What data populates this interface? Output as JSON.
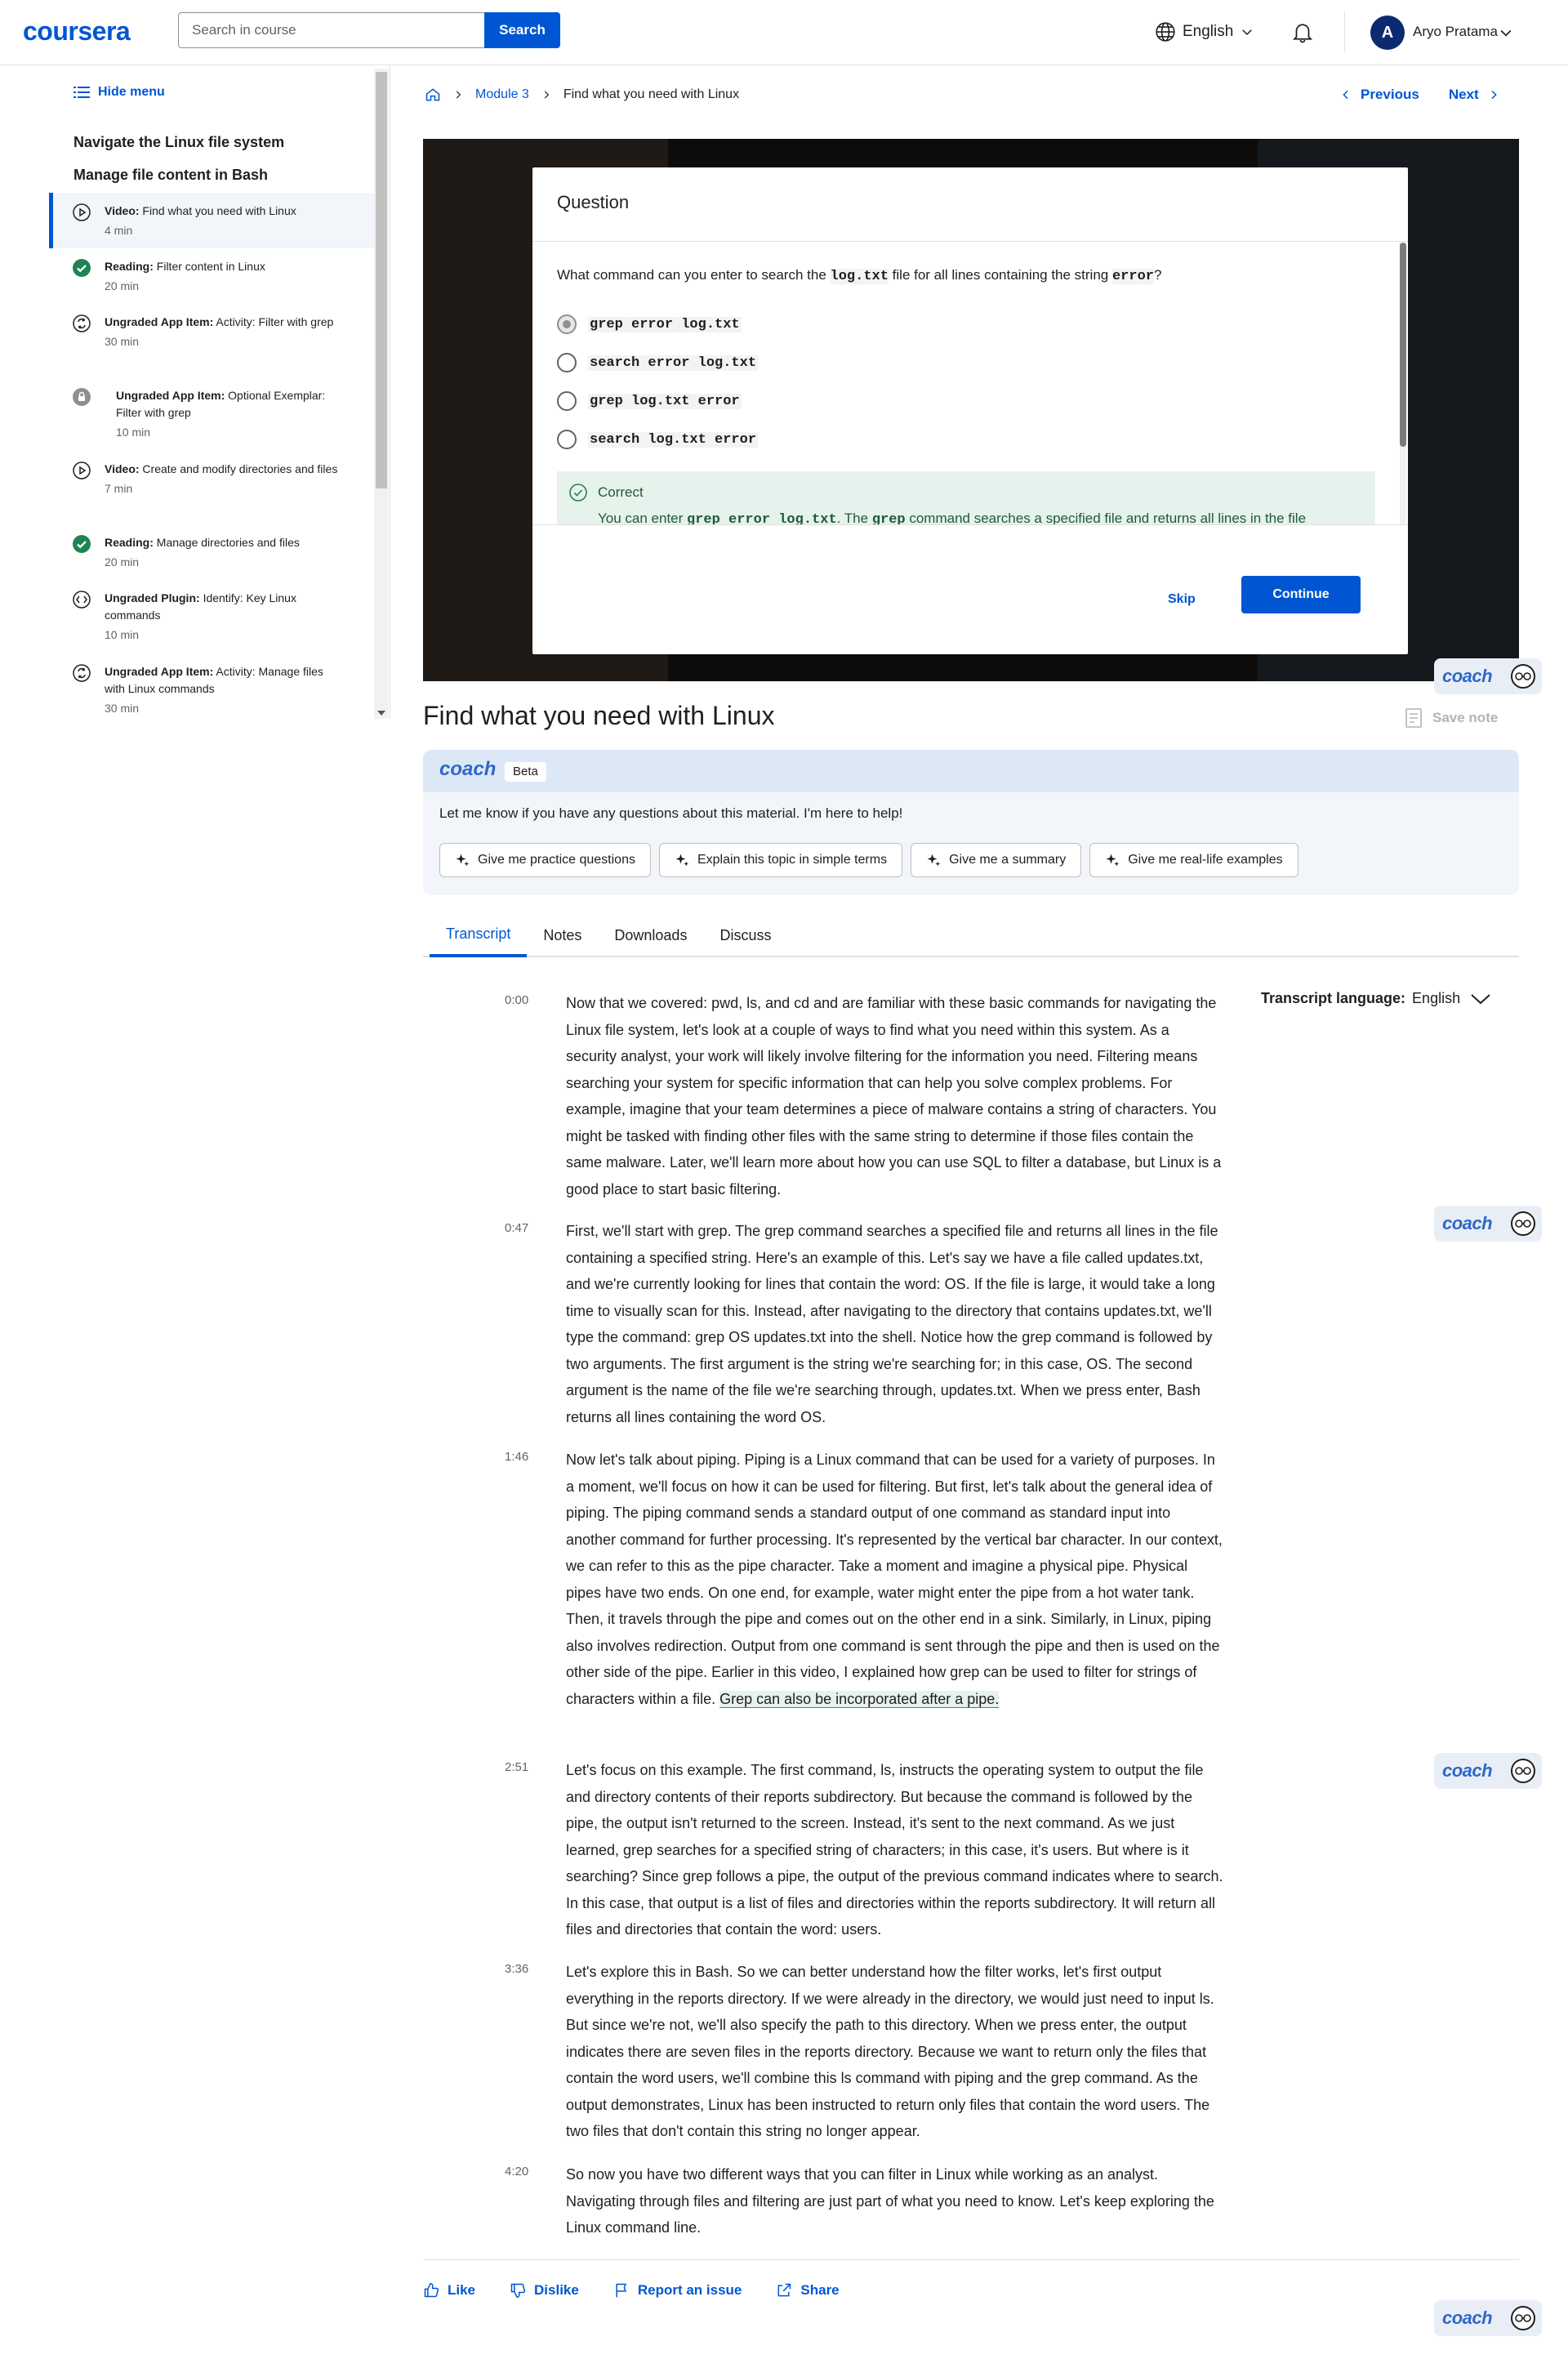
{
  "header": {
    "logo": "coursera",
    "search_placeholder": "Search in course",
    "search_button": "Search",
    "language": "English",
    "avatar_initial": "A",
    "user_name": "Aryo Pratama"
  },
  "sidebar": {
    "hide_menu": "Hide menu",
    "sections": [
      "Navigate the Linux file system",
      "Manage file content in Bash"
    ],
    "items": [
      {
        "type": "Video:",
        "title": "Find what you need with Linux",
        "duration": "4 min",
        "icon": "play-circle-icon",
        "active": true
      },
      {
        "type": "Reading:",
        "title": "Filter content in Linux",
        "duration": "20 min",
        "icon": "check-circle-icon"
      },
      {
        "type": "Ungraded App Item:",
        "title": "Activity: Filter with grep",
        "duration": "30 min",
        "icon": "app-item-icon"
      },
      {
        "type": "Ungraded App Item:",
        "title": "Optional Exemplar: Filter with grep",
        "duration": "10 min",
        "icon": "lock-icon"
      },
      {
        "type": "Video:",
        "title": "Create and modify directories and files",
        "duration": "7 min",
        "icon": "play-circle-icon"
      },
      {
        "type": "Reading:",
        "title": "Manage directories and files",
        "duration": "20 min",
        "icon": "check-circle-icon"
      },
      {
        "type": "Ungraded Plugin:",
        "title": "Identify: Key Linux commands",
        "duration": "10 min",
        "icon": "plugin-icon"
      },
      {
        "type": "Ungraded App Item:",
        "title": "Activity: Manage files with Linux commands",
        "duration": "30 min",
        "icon": "app-item-icon"
      }
    ]
  },
  "breadcrumb": {
    "module": "Module 3",
    "current": "Find what you need with Linux"
  },
  "nav": {
    "previous": "Previous",
    "next": "Next"
  },
  "quiz": {
    "title": "Question",
    "q_pre": "What command can you enter to search the ",
    "q_file": "log.txt",
    "q_mid": " file for all lines containing the string ",
    "q_str": "error",
    "q_post": "?",
    "options": [
      "grep error log.txt",
      "search error log.txt",
      "grep log.txt error",
      "search log.txt error"
    ],
    "selected_index": 0,
    "feedback_title": "Correct",
    "feedback_pre": "You can enter ",
    "feedback_cmd": "grep error log.txt",
    "feedback_mid": ". The ",
    "feedback_grep": "grep",
    "feedback_rest": " command searches a specified file and returns all lines in the file containing a specified string. Its first argument is the string you are searching for. Its second argument is the file you are searching through.",
    "skip": "Skip",
    "continue": "Continue"
  },
  "coach": {
    "label": "coach",
    "beta": "Beta",
    "message": "Let me know if you have any questions about this material. I'm here to help!",
    "chips": [
      "Give me practice questions",
      "Explain this topic in simple terms",
      "Give me a summary",
      "Give me real-life examples"
    ]
  },
  "page_title": "Find what you need with Linux",
  "save_note": "Save note",
  "tabs": [
    "Transcript",
    "Notes",
    "Downloads",
    "Discuss"
  ],
  "transcript_language": {
    "label": "Transcript language:",
    "value": "English"
  },
  "transcript": [
    {
      "time": "0:00",
      "text": "Now that we covered: pwd, ls, and cd and are familiar with these basic commands for navigating the Linux file system, let's look at a couple of ways to find what you need within this system. As a security analyst, your work will likely involve filtering for the information you need. Filtering means searching your system for specific information that can help you solve complex problems. For example, imagine that your team determines a piece of malware contains a string of characters. You might be tasked with finding other files with the same string to determine if those files contain the same malware. Later, we'll learn more about how you can use SQL to filter a database, but Linux is a good place to start basic filtering."
    },
    {
      "time": "0:47",
      "text": "First, we'll start with grep. The grep command searches a specified file and returns all lines in the file containing a specified string. Here's an example of this. Let's say we have a file called updates.txt, and we're currently looking for lines that contain the word: OS. If the file is large, it would take a long time to visually scan for this. Instead, after navigating to the directory that contains updates.txt, we'll type the command: grep OS updates.txt into the shell. Notice how the grep command is followed by two arguments. The first argument is the string we're searching for; in this case, OS. The second argument is the name of the file we're searching through, updates.txt. When we press enter, Bash returns all lines containing the word OS."
    },
    {
      "time": "1:46",
      "text": "Now let's talk about piping. Piping is a Linux command that can be used for a variety of purposes. In a moment, we'll focus on how it can be used for filtering. But first, let's talk about the general idea of piping. The piping command sends a standard output of one command as standard input into another command for further processing. It's represented by the vertical bar character. In our context, we can refer to this as the pipe character. Take a moment and imagine a physical pipe. Physical pipes have two ends. On one end, for example, water might enter the pipe from a hot water tank. Then, it travels through the pipe and comes out on the other end in a sink. Similarly, in Linux, piping also involves redirection. Output from one command is sent through the pipe and then is used on the other side of the pipe. Earlier in this video, I explained how grep can be used to filter for strings of characters within a file.",
      "highlight": "Grep can also be incorporated after a pipe."
    },
    {
      "time": "2:51",
      "text": "Let's focus on this example. The first command, ls, instructs the operating system to output the file and directory contents of their reports subdirectory. But because the command is followed by the pipe, the output isn't returned to the screen. Instead, it's sent to the next command. As we just learned, grep searches for a specified string of characters; in this case, it's users. But where is it searching? Since grep follows a pipe, the output of the previous command indicates where to search. In this case, that output is a list of files and directories within the reports subdirectory. It will return all files and directories that contain the word: users."
    },
    {
      "time": "3:36",
      "text": "Let's explore this in Bash. So we can better understand how the filter works, let's first output everything in the reports directory. If we were already in the directory, we would just need to input ls. But since we're not, we'll also specify the path to this directory. When we press enter, the output indicates there are seven files in the reports directory. Because we want to return only the files that contain the word users, we'll combine this ls command with piping and the grep command. As the output demonstrates, Linux has been instructed to return only files that contain the word users. The two files that don't contain this string no longer appear."
    },
    {
      "time": "4:20",
      "text": "So now you have two different ways that you can filter in Linux while working as an analyst. Navigating through files and filtering are just part of what you need to know. Let's keep exploring the Linux command line."
    }
  ],
  "actions": [
    "Like",
    "Dislike",
    "Report an issue",
    "Share"
  ],
  "colors": {
    "brand": "#0056d2",
    "correct_bg": "#e6f2ec",
    "coach": "#2e68c9"
  }
}
